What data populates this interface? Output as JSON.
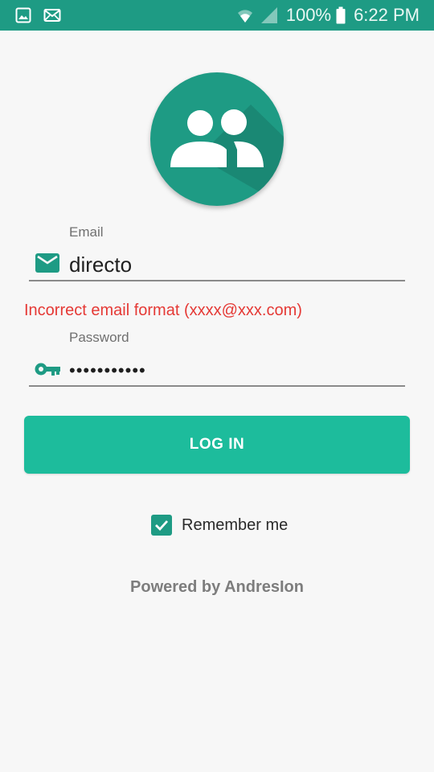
{
  "status_bar": {
    "battery_text": "100%",
    "time": "6:22 PM",
    "left_icons": [
      "gallery-icon",
      "mail-icon"
    ],
    "right_icons": [
      "wifi-icon",
      "signal-icon",
      "battery-icon"
    ],
    "color": "#1e9b84"
  },
  "login": {
    "avatar_icon": "people-group-icon",
    "email": {
      "label": "Email",
      "value": "directo",
      "icon": "mail-icon",
      "error": "Incorrect email format (xxxx@xxx.com)"
    },
    "password": {
      "label": "Password",
      "value": "•••••••••••",
      "icon": "key-icon"
    },
    "button_label": "LOG IN",
    "remember": {
      "label": "Remember me",
      "checked": true
    },
    "footer": "Powered by AndresIon"
  },
  "colors": {
    "accent": "#1e9b84",
    "button": "#1dbc9c",
    "error": "#e53935",
    "background": "#f7f7f7"
  }
}
